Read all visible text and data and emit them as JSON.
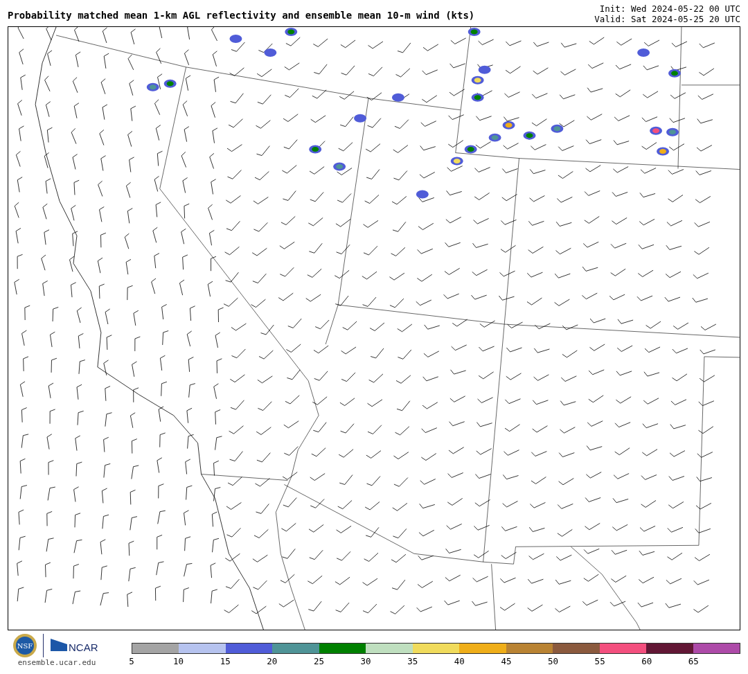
{
  "title": "Probability matched mean 1-km AGL reflectivity and ensemble mean 10-m wind (kts)",
  "times": [
    "Init: Wed 2024-05-22 00 UTC",
    "Valid: Sat 2024-05-25 20 UTC"
  ],
  "logos": {
    "nsf": "NSF",
    "ncar": "NCAR",
    "url": "ensemble.ucar.edu"
  },
  "colorbar": {
    "ticks": [
      "5",
      "10",
      "15",
      "20",
      "25",
      "30",
      "35",
      "40",
      "45",
      "50",
      "55",
      "60",
      "65"
    ],
    "bins": [
      {
        "color": "#a4a4a4"
      },
      {
        "color": "#b6c3ef"
      },
      {
        "color": "#505cd8"
      },
      {
        "color": "#4f9497"
      },
      {
        "color": "#008000"
      },
      {
        "color": "#bfdfbf"
      },
      {
        "color": "#f0db5c"
      },
      {
        "color": "#efae19"
      },
      {
        "color": "#b98333"
      },
      {
        "color": "#8b5a3e"
      },
      {
        "color": "#f34f7e"
      },
      {
        "color": "#621735"
      },
      {
        "color": "#ad4aa8"
      }
    ]
  }
}
